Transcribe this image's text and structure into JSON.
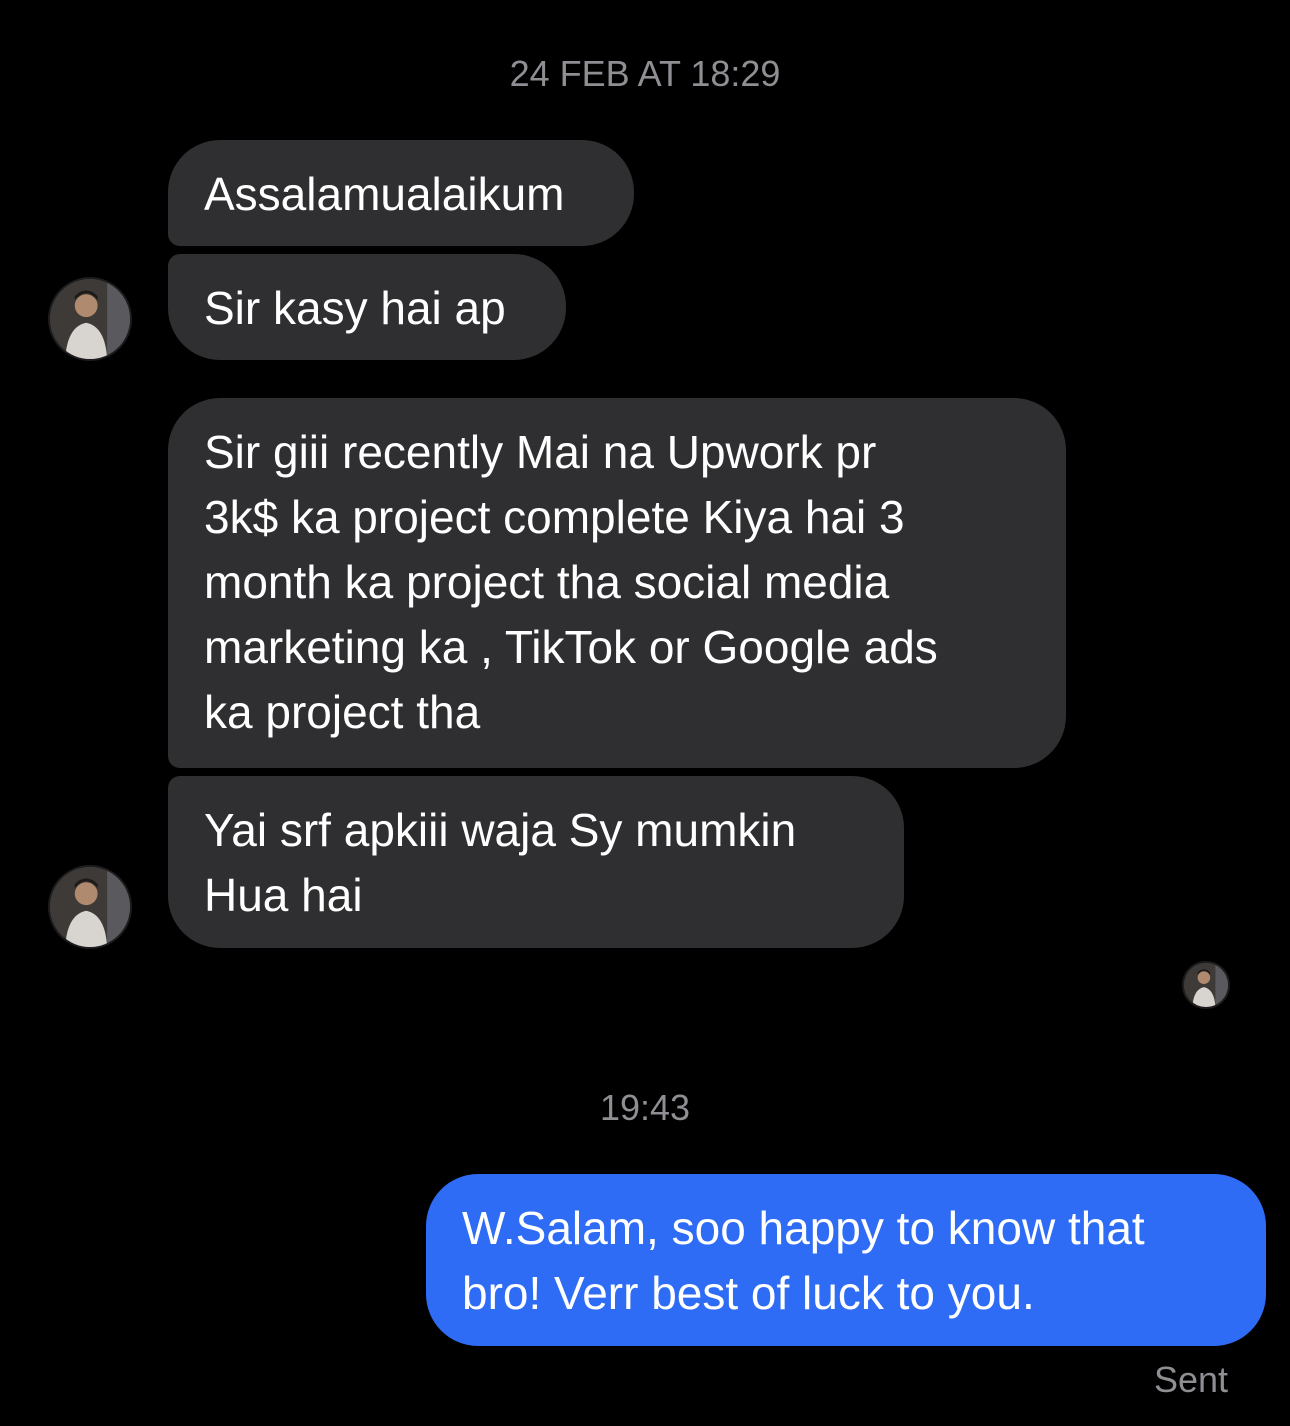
{
  "conversation": {
    "timestamp_1": "24 FEB AT 18:29",
    "timestamp_2": "19:43",
    "messages": [
      {
        "sender": "contact",
        "text": "Assalamualaikum"
      },
      {
        "sender": "contact",
        "text": "Sir kasy hai ap"
      },
      {
        "sender": "contact",
        "text": "Sir giii recently Mai na Upwork pr\n3k$ ka project complete Kiya hai 3\nmonth ka project tha social media\nmarketing ka , TikTok or Google ads\nka project tha"
      },
      {
        "sender": "contact",
        "text": "Yai srf apkiii waja Sy mumkin\nHua hai"
      },
      {
        "sender": "me",
        "text": "W.Salam, soo happy to know that\nbro! Verr best of luck to you."
      }
    ],
    "status": "Sent"
  },
  "colors": {
    "background": "#000000",
    "incoming_bubble": "#2f2f31",
    "outgoing_bubble": "#2e6cf6",
    "meta_text": "#8e8e93"
  },
  "icons": {
    "contact_avatar": "avatar-photo",
    "read_receipt": "seen-avatar"
  }
}
